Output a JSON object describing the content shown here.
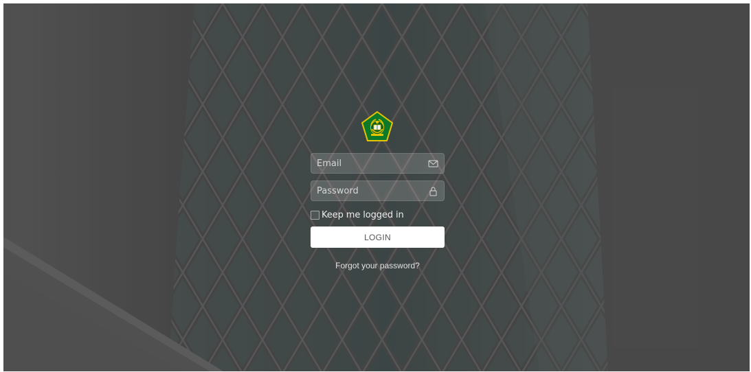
{
  "page": {
    "background": "blurred-building-facade-photo",
    "overlay_color": "#3a3a3a"
  },
  "logo": {
    "icon": "ministry-emblem-icon",
    "colors": {
      "green": "#0d7a2a",
      "gold": "#e8c400"
    }
  },
  "form": {
    "email": {
      "value": "",
      "placeholder": "Email",
      "icon": "envelope-icon"
    },
    "password": {
      "value": "",
      "placeholder": "Password",
      "icon": "lock-icon"
    },
    "remember_label": "Keep me logged in",
    "remember_checked": false,
    "login_label": "LOGIN",
    "forgot_label": "Forgot your password?"
  }
}
